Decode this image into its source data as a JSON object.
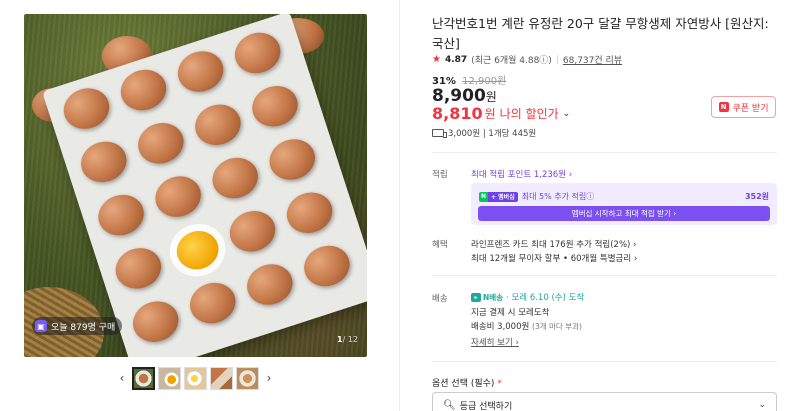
{
  "gallery": {
    "buy_badge": "오늘 879명 구매",
    "counter_current": "1",
    "counter_total": "/ 12",
    "prev_arrow": "‹",
    "next_arrow": "›"
  },
  "product": {
    "title": "난각번호1번 계란 유정란 20구 달걀 무항생제 자연방사 [원산지: 국산]",
    "rating": "4.87",
    "rating_recent": "(최근 6개월 4.88ⓘ)",
    "reviews": "68,737건 리뷰",
    "discount_pct": "31%",
    "original_price": "12,900원",
    "price": "8,900",
    "price_unit": "원",
    "my_price": "8,810",
    "my_price_unit": "원",
    "my_price_label": "나의 할인가",
    "coupon_label": "쿠폰 받기",
    "delivery_summary": "3,000원 | 1개당 445원"
  },
  "points": {
    "section_label": "적립",
    "max_points": "최대 적립 포인트 1,236원 ›",
    "badge_n": "N",
    "badge_plus": "+ 멤버십",
    "member_extra": "최대 5% 추가 적립ⓘ",
    "member_amount": "352원",
    "member_button": "멤버십 시작하고 최대 적립 받기 ›"
  },
  "benefits": {
    "section_label": "혜택",
    "line1": "라인프렌즈 카드 최대 176원 추가 적립(2%) ›",
    "line2": "최대 12개월 무이자 할부 • 60개월 특별금리 ›"
  },
  "shipping": {
    "section_label": "배송",
    "fast_label": "N배송",
    "fast_arrival": "· 모레 6.10 (수) 도착",
    "line1": "지금 결제 시 모레도착",
    "fee": "배송비 3,000원",
    "fee_note": "(3개 마다 부과)",
    "detail_link": "자세히 보기 ›"
  },
  "option": {
    "label": "옵션 선택 (필수)",
    "required_mark": "*",
    "placeholder": "등급 선택하기"
  },
  "colors": {
    "accent_red": "#f5333f",
    "membership_purple": "#6b43e8",
    "fast_delivery_teal": "#1fa99b"
  }
}
